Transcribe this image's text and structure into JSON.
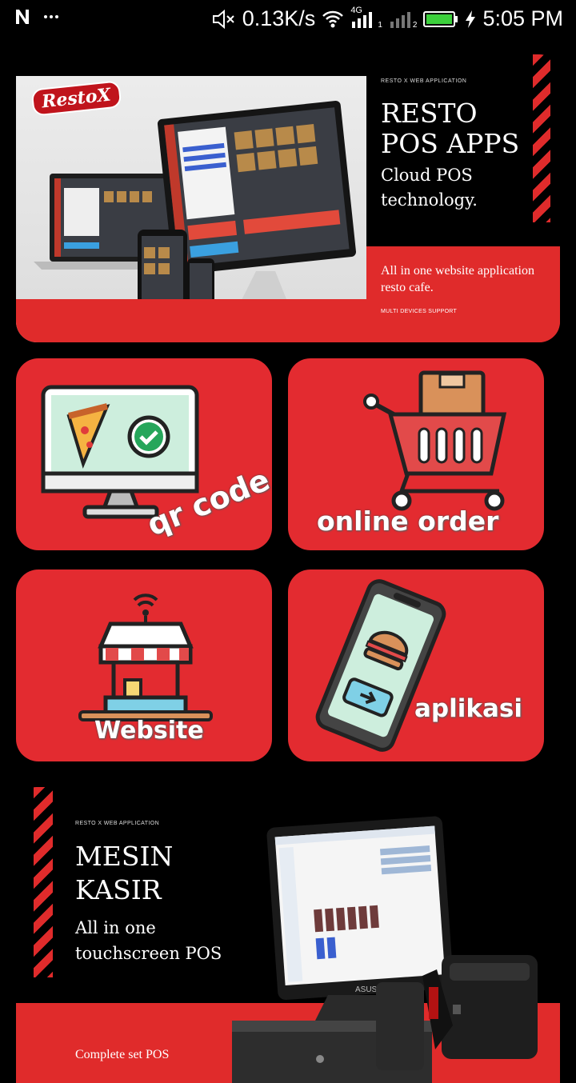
{
  "status_bar": {
    "network_speed": "0.13K/s",
    "network_type": "4G",
    "sim1": "1",
    "sim2": "2",
    "time": "5:05 PM",
    "icons": [
      "notification-n-icon",
      "more-dots-icon",
      "mute-icon",
      "wifi-icon",
      "signal-icon",
      "battery-icon",
      "charging-icon"
    ]
  },
  "banner1": {
    "logo": "RestoX",
    "tag": "RESTO X WEB APPLICATION",
    "title_line1": "RESTO",
    "title_line2": "POS APPS",
    "subtitle_line1": "Cloud POS",
    "subtitle_line2": "technology.",
    "description": "All in one website application resto cafe.",
    "footnote": "MULTI DEVICES SUPPORT"
  },
  "tiles": [
    {
      "label": "qr code",
      "icon": "monitor-pizza-check-icon"
    },
    {
      "label": "online order",
      "icon": "shopping-cart-icon"
    },
    {
      "label": "Website",
      "icon": "shop-stand-wifi-icon"
    },
    {
      "label": "aplikasi",
      "icon": "phone-burger-icon"
    }
  ],
  "banner2": {
    "tag": "RESTO X WEB APPLICATION",
    "title_line1": "MESIN",
    "title_line2": "KASIR",
    "subtitle_line1": "All in one",
    "subtitle_line2": "touchscreen POS",
    "footer": "Complete set POS",
    "monitor_brand": "ASUS"
  },
  "colors": {
    "accent_red": "#e32b30",
    "background": "#000000"
  }
}
